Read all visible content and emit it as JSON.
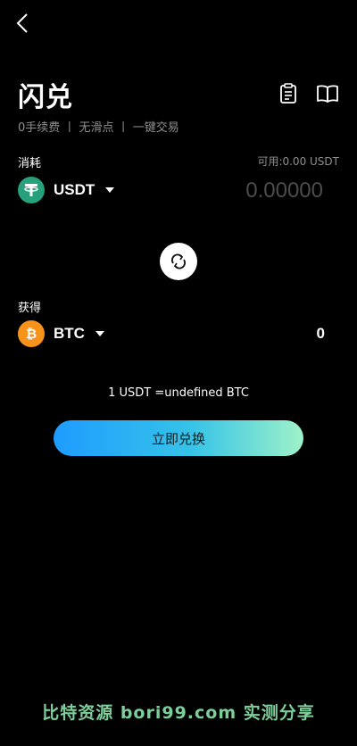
{
  "header": {
    "title": "闪兑",
    "subtitle": "0手续费 丨 无滑点 丨 一键交易",
    "icons": [
      "back-arrow-icon",
      "orders-clipboard-icon",
      "guide-book-icon"
    ]
  },
  "pay": {
    "label": "消耗",
    "available": "可用:0.00 USDT",
    "coin": "USDT",
    "coin_color": "#26a17b",
    "amount_placeholder": "0.00000"
  },
  "receive": {
    "label": "获得",
    "coin": "BTC",
    "coin_color": "#f7931a",
    "amount": "0"
  },
  "rate_text": "1 USDT =undefined BTC",
  "cta_label": "立即兑换",
  "watermark": "比特资源 bori99.com 实测分享",
  "colors": {
    "background": "#000000",
    "cta_gradient_start": "#1e9cff",
    "cta_gradient_end": "#9ef2c8",
    "muted_text": "#8e8e8e"
  }
}
